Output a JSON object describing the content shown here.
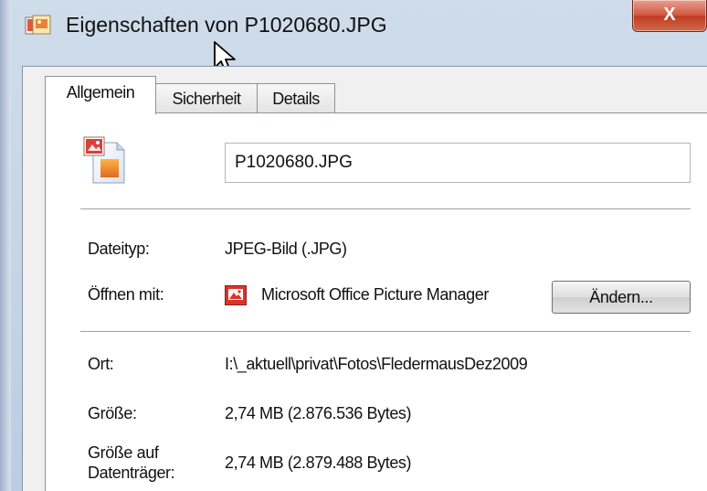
{
  "window": {
    "title": "Eigenschaften von P1020680.JPG",
    "close_glyph": "X"
  },
  "tabs": [
    {
      "label": "Allgemein",
      "active": true
    },
    {
      "label": "Sicherheit",
      "active": false
    },
    {
      "label": "Details",
      "active": false
    }
  ],
  "general": {
    "file_name": "P1020680.JPG",
    "filetype_label": "Dateityp:",
    "filetype_value": "JPEG-Bild (.JPG)",
    "open_with_label": "Öffnen mit:",
    "open_with_app": "Microsoft Office Picture Manager",
    "change_button": "Ändern...",
    "location_label": "Ort:",
    "location_value": "I:\\_aktuell\\privat\\Fotos\\FledermausDez2009",
    "size_label": "Größe:",
    "size_value": "2,74 MB (2.876.536 Bytes)",
    "disk_size_label_line1": "Größe auf",
    "disk_size_label_line2": "Datenträger:",
    "disk_size_value": "2,74 MB (2.879.488 Bytes)"
  },
  "icons": {
    "title": "image-properties-icon",
    "file": "jpeg-file-icon",
    "app": "picture-manager-icon",
    "cursor": "mouse-pointer-icon"
  },
  "colors": {
    "close_button": "#c9452c",
    "window_frame": "#c4d4e6",
    "dialog_background": "#f0f0f0"
  }
}
